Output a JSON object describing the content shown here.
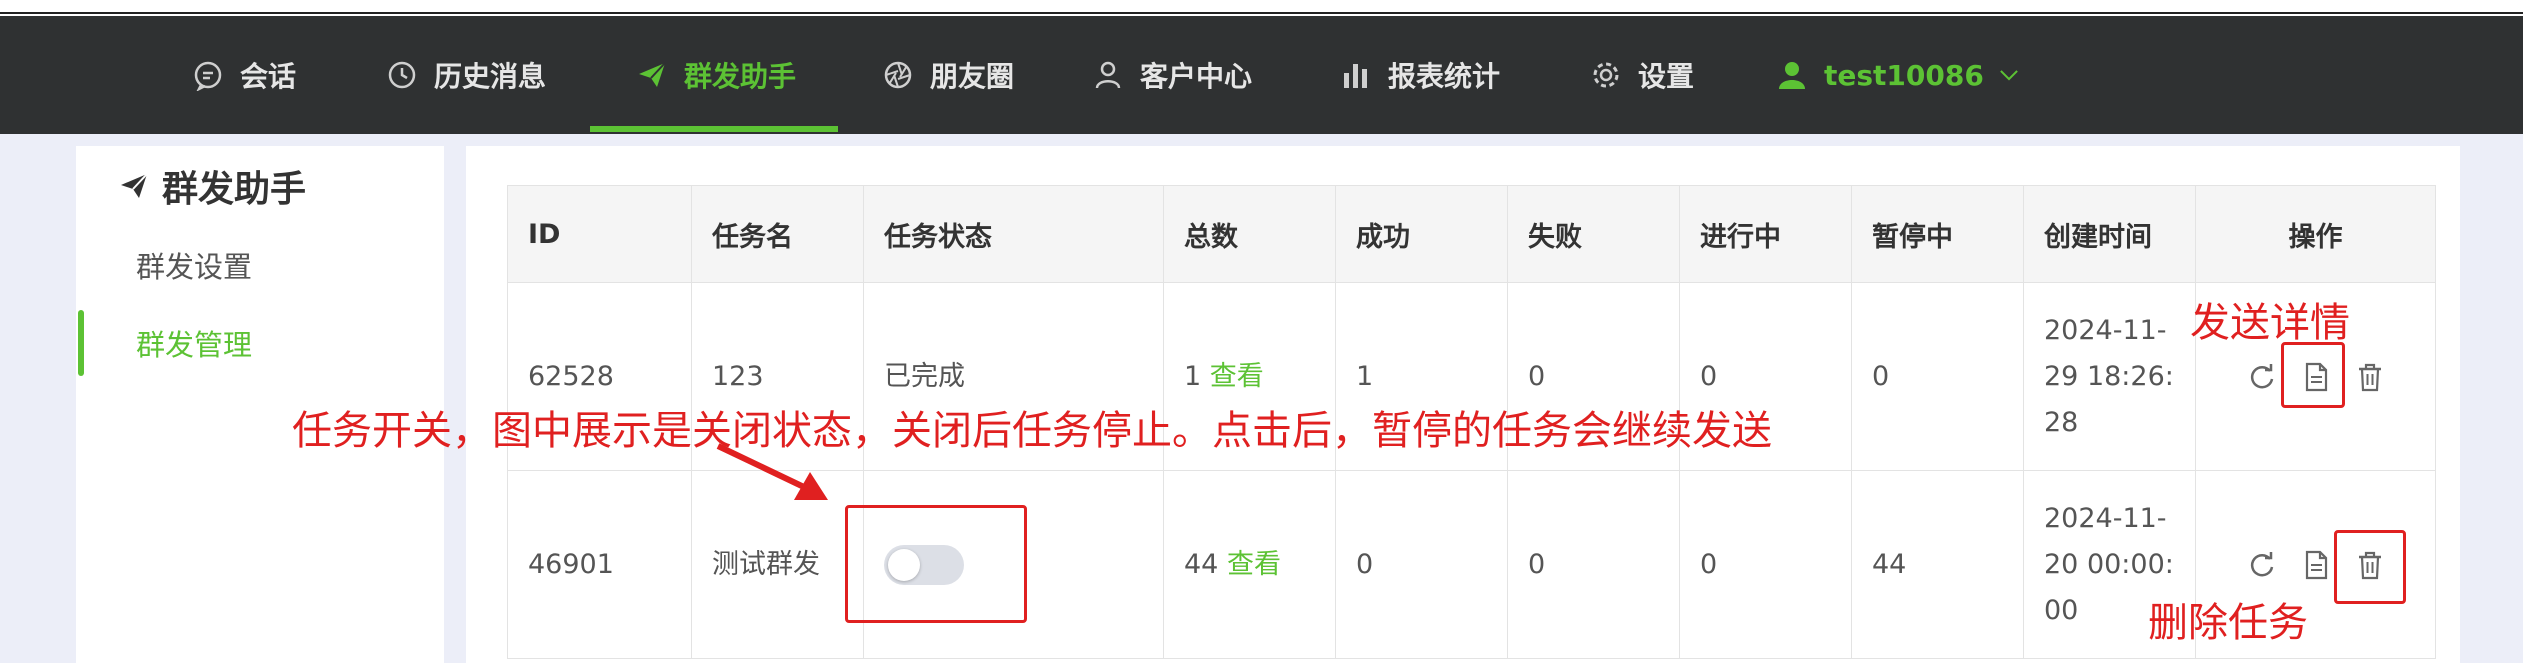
{
  "nav": {
    "items": [
      {
        "label": "会话",
        "icon": "chat-icon"
      },
      {
        "label": "历史消息",
        "icon": "clock-icon"
      },
      {
        "label": "群发助手",
        "icon": "paper-plane-icon",
        "active": true
      },
      {
        "label": "朋友圈",
        "icon": "aperture-icon"
      },
      {
        "label": "客户中心",
        "icon": "user-icon"
      },
      {
        "label": "报表统计",
        "icon": "bar-chart-icon"
      },
      {
        "label": "设置",
        "icon": "gear-icon"
      }
    ],
    "user": {
      "name": "test10086",
      "icon": "user-icon"
    },
    "accent": "#5cc234"
  },
  "sidebar": {
    "title": "群发助手",
    "items": [
      {
        "label": "群发设置",
        "active": false
      },
      {
        "label": "群发管理",
        "active": true
      }
    ]
  },
  "table": {
    "headers": [
      "ID",
      "任务名",
      "任务状态",
      "总数",
      "成功",
      "失败",
      "进行中",
      "暂停中",
      "创建时间",
      "操作"
    ],
    "view_label": "查看",
    "rows": [
      {
        "id": "62528",
        "name": "123",
        "status": "已完成",
        "total": "1",
        "success": "1",
        "fail": "0",
        "running": "0",
        "paused": "0",
        "created": [
          "2024-11-",
          "29 18:26:",
          "28"
        ]
      },
      {
        "id": "46901",
        "name": "测试群发",
        "status": "",
        "toggle": "off",
        "total": "44",
        "success": "0",
        "fail": "0",
        "running": "0",
        "paused": "44",
        "created": [
          "2024-11-",
          "20 00:00:",
          "00"
        ]
      }
    ]
  },
  "annotations": {
    "send_detail": "发送详情",
    "toggle_note": "任务开关，图中展示是关闭状态，关闭后任务停止。点击后，暂停的任务会继续发送",
    "delete_task": "删除任务",
    "color": "#e02020"
  }
}
